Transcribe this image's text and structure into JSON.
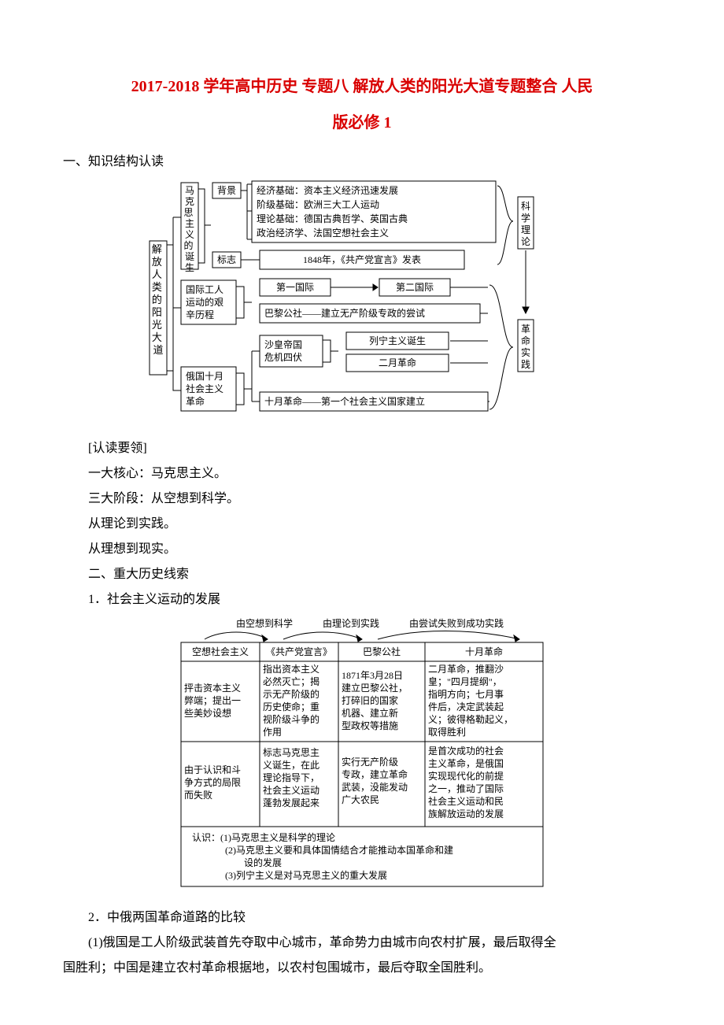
{
  "title_line1": "2017-2018 学年高中历史 专题八 解放人类的阳光大道专题整合 人民",
  "title_line2": "版必修 1",
  "section1_heading": "一、知识结构认读",
  "diagram1": {
    "root": "解放人类的阳光大道",
    "branch_a": {
      "label": "马克思主义的诞生",
      "bg_label": "背景",
      "bg_lines": [
        "经济基础：资本主义经济迅速发展",
        "阶级基础：欧洲三大工人运动",
        "理论基础：德国古典哲学、英国古典",
        "政治经济学、法国空想社会主义"
      ],
      "mark_label": "标志",
      "mark_line": "1848年，《共产党宣言》发表"
    },
    "branch_b": {
      "label1": "国际工人",
      "label2": "运动的艰",
      "label3": "辛历程",
      "line1a": "第一国际",
      "line1b": "第二国际",
      "line2": "巴黎公社——建立无产阶级专政的尝试"
    },
    "branch_c": {
      "label1": "俄国十月",
      "label2": "社会主义",
      "label3": "革命",
      "sha1": "沙皇帝国",
      "sha2": "危机四伏",
      "res1": "列宁主义诞生",
      "res2": "二月革命",
      "oct": "十月革命——第一个社会主义国家建立"
    },
    "side_top": "科学理论",
    "side_bot": "革命实践"
  },
  "reading_heading": "[认读要领]",
  "reading_line1": "一大核心：马克思主义。",
  "reading_line2": "三大阶段：从空想到科学。",
  "reading_line3": "从理论到实践。",
  "reading_line4": "从理想到现实。",
  "section2_heading": "二、重大历史线索",
  "section2_item1": "1．社会主义运动的发展",
  "table": {
    "top_labels": [
      "由空想到科学",
      "由理论到实践",
      "由尝试失败到成功实践"
    ],
    "header": [
      "空想社会主义",
      "《共产党宣言》",
      "巴黎公社",
      "十月革命"
    ],
    "row1_c1a": "抨击资本主义",
    "row1_c1b": "弊端；提出一",
    "row1_c1c": "些美妙设想",
    "row1_c2": [
      "指出资本主义",
      "必然灭亡；揭",
      "示无产阶级的",
      "历史使命；重",
      "视阶级斗争的",
      "作用"
    ],
    "row1_c3": [
      "1871年3月28日",
      "建立巴黎公社，",
      "打碎旧的国家",
      "机器、建立新",
      "型政权等措施"
    ],
    "row1_c4": [
      "二月革命，推翻沙",
      "皇；\"四月提纲\"，",
      "指明方向；七月事",
      "件后，决定武装起",
      "义；彼得格勒起义，",
      "取得胜利"
    ],
    "row2_c1a": "由于认识和斗",
    "row2_c1b": "争方式的局限",
    "row2_c1c": "而失败",
    "row2_c2": [
      "标志马克思主",
      "义诞生，在此",
      "理论指导下，",
      "社会主义运动",
      "蓬勃发展起来"
    ],
    "row2_c3": [
      "实行无产阶级",
      "专政，建立革命",
      "武装，没能发动",
      "广大农民"
    ],
    "row2_c4": [
      "是首次成功的社会",
      "主义革命，是俄国",
      "实现现代化的前提",
      "之一，推动了国际",
      "社会主义运动和民",
      "族解放运动的发展"
    ],
    "footer": [
      "认识：(1)马克思主义是科学的理论",
      "(2)马克思主义要和具体国情结合才能推动本国革命和建",
      "设的发展",
      "(3)列宁主义是对马克思主义的重大发展"
    ]
  },
  "section2_item2": "2．中俄两国革命道路的比较",
  "p_last1": "(1)俄国是工人阶级武装首先夺取中心城市，革命势力由城市向农村扩展，最后取得全",
  "p_last2": "国胜利；中国是建立农村革命根据地，以农村包围城市，最后夺取全国胜利。"
}
